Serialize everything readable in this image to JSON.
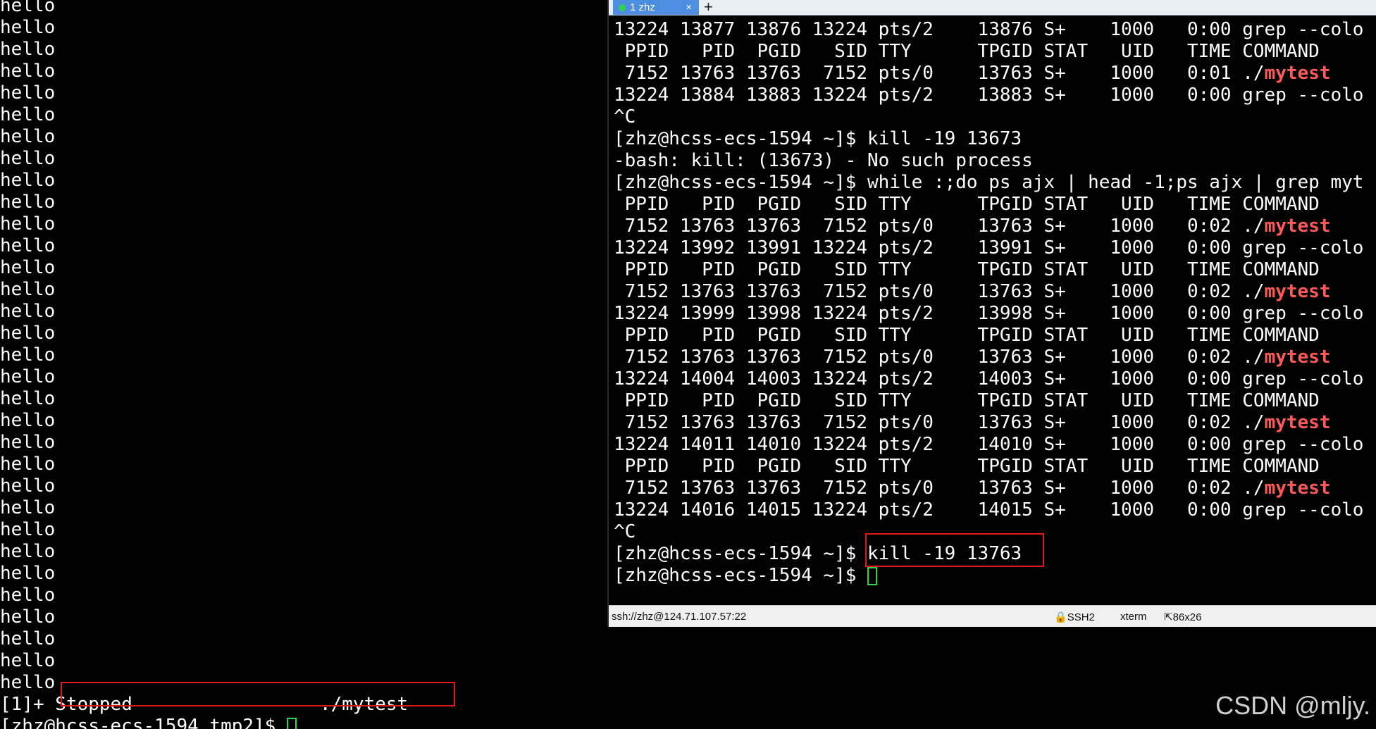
{
  "left_terminal": {
    "repeat_line": "hello",
    "repeat_count": 32,
    "job_prefix": "[1]+ ",
    "job_status_line": "Stopped                 ./mytest",
    "prompt": "[zhz@hcss-ecs-1594 tmp2]$ "
  },
  "right_window": {
    "tab": {
      "label": "1 zhz",
      "close": "×",
      "add": "+"
    },
    "lines": [
      {
        "t": "13224 13877 13876 13224 pts/2    13876 S+    1000   0:00 grep --colo"
      },
      {
        "t": " PPID   PID  PGID   SID TTY      TPGID STAT   UID   TIME COMMAND"
      },
      {
        "t": " 7152 13763 13763  7152 pts/0    13763 S+    1000   0:01 ./",
        "hl": "mytest"
      },
      {
        "t": "13224 13884 13883 13224 pts/2    13883 S+    1000   0:00 grep --colo"
      },
      {
        "t": "^C"
      },
      {
        "t": "[zhz@hcss-ecs-1594 ~]$ kill -19 13673"
      },
      {
        "t": "-bash: kill: (13673) - No such process"
      },
      {
        "t": "[zhz@hcss-ecs-1594 ~]$ while :;do ps ajx | head -1;ps ajx | grep myt"
      },
      {
        "t": " PPID   PID  PGID   SID TTY      TPGID STAT   UID   TIME COMMAND"
      },
      {
        "t": " 7152 13763 13763  7152 pts/0    13763 S+    1000   0:02 ./",
        "hl": "mytest"
      },
      {
        "t": "13224 13992 13991 13224 pts/2    13991 S+    1000   0:00 grep --colo"
      },
      {
        "t": " PPID   PID  PGID   SID TTY      TPGID STAT   UID   TIME COMMAND"
      },
      {
        "t": " 7152 13763 13763  7152 pts/0    13763 S+    1000   0:02 ./",
        "hl": "mytest"
      },
      {
        "t": "13224 13999 13998 13224 pts/2    13998 S+    1000   0:00 grep --colo"
      },
      {
        "t": " PPID   PID  PGID   SID TTY      TPGID STAT   UID   TIME COMMAND"
      },
      {
        "t": " 7152 13763 13763  7152 pts/0    13763 S+    1000   0:02 ./",
        "hl": "mytest"
      },
      {
        "t": "13224 14004 14003 13224 pts/2    14003 S+    1000   0:00 grep --colo"
      },
      {
        "t": " PPID   PID  PGID   SID TTY      TPGID STAT   UID   TIME COMMAND"
      },
      {
        "t": " 7152 13763 13763  7152 pts/0    13763 S+    1000   0:02 ./",
        "hl": "mytest"
      },
      {
        "t": "13224 14011 14010 13224 pts/2    14010 S+    1000   0:00 grep --colo"
      },
      {
        "t": " PPID   PID  PGID   SID TTY      TPGID STAT   UID   TIME COMMAND"
      },
      {
        "t": " 7152 13763 13763  7152 pts/0    13763 S+    1000   0:02 ./",
        "hl": "mytest"
      },
      {
        "t": "13224 14016 14015 13224 pts/2    14015 S+    1000   0:00 grep --colo"
      },
      {
        "t": "^C"
      },
      {
        "t": "[zhz@hcss-ecs-1594 ~]$ kill -19 13763"
      },
      {
        "t": "[zhz@hcss-ecs-1594 ~]$ ",
        "cursor": true
      }
    ],
    "statusbar": {
      "connection": "ssh://zhz@124.71.107.57:22",
      "protocol": "SSH2",
      "terminal_type": "xterm",
      "size": "86x26"
    }
  },
  "watermark": "CSDN @mljy.",
  "colors": {
    "highlight": "#ff5a5a",
    "cursor": "#2fd34e",
    "annotation_box": "#e01818",
    "tab": "#4d8ee0"
  }
}
